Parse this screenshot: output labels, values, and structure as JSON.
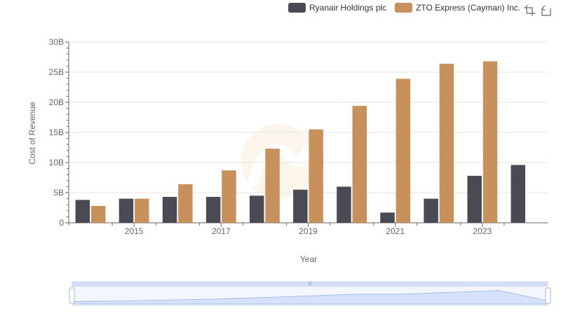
{
  "legend": [
    {
      "label": "Ryanair Holdings plc",
      "color": "#4a4a55"
    },
    {
      "label": "ZTO Express (Cayman) Inc.",
      "color": "#c8905a"
    }
  ],
  "toolbar": {
    "zoom_icon": "zoom-select-icon",
    "restore_icon": "restore-icon"
  },
  "chart_data": {
    "type": "bar",
    "xlabel": "Year",
    "ylabel": "Cost of Revenue",
    "ylim": [
      0,
      30
    ],
    "yticks": [
      "0",
      "5B",
      "10B",
      "15B",
      "20B",
      "25B",
      "30B"
    ],
    "x_tick_labels": [
      "2015",
      "2017",
      "2019",
      "2021",
      "2023"
    ],
    "categories": [
      "2014",
      "2015",
      "2016",
      "2017",
      "2018",
      "2019",
      "2020",
      "2021",
      "2022",
      "2023",
      "2024"
    ],
    "series": [
      {
        "name": "Ryanair Holdings plc",
        "color": "#4a4a55",
        "values": [
          3.8,
          4.0,
          4.3,
          4.3,
          4.5,
          5.5,
          6.0,
          1.7,
          4.0,
          7.8,
          9.6
        ]
      },
      {
        "name": "ZTO Express (Cayman) Inc.",
        "color": "#c8905a",
        "values": [
          2.8,
          4.0,
          6.4,
          8.7,
          12.3,
          15.5,
          19.4,
          23.9,
          26.4,
          26.8,
          null
        ]
      }
    ],
    "grid": true,
    "legend_position": "top-right"
  }
}
